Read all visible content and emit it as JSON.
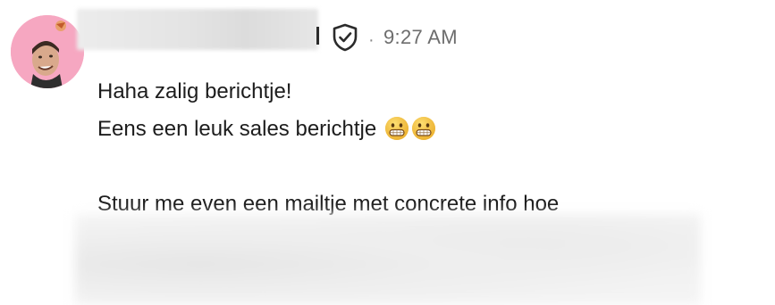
{
  "message": {
    "author_name": "",
    "time": "9:27 AM",
    "separator": "·",
    "lines": [
      "Haha zalig berichtje!",
      "Eens een leuk sales berichtje",
      "",
      "Stuur me even een mailtje met concrete info hoe"
    ],
    "emoji": [
      "grinning-face-emoji",
      "grinning-face-emoji"
    ]
  },
  "icons": {
    "verified": "shield-check-icon",
    "avatar_badge": "small-emoji-badge"
  },
  "colors": {
    "avatar_bg": "#f6a7c1",
    "text": "#1d1d1d",
    "time": "#6d6d6d"
  }
}
